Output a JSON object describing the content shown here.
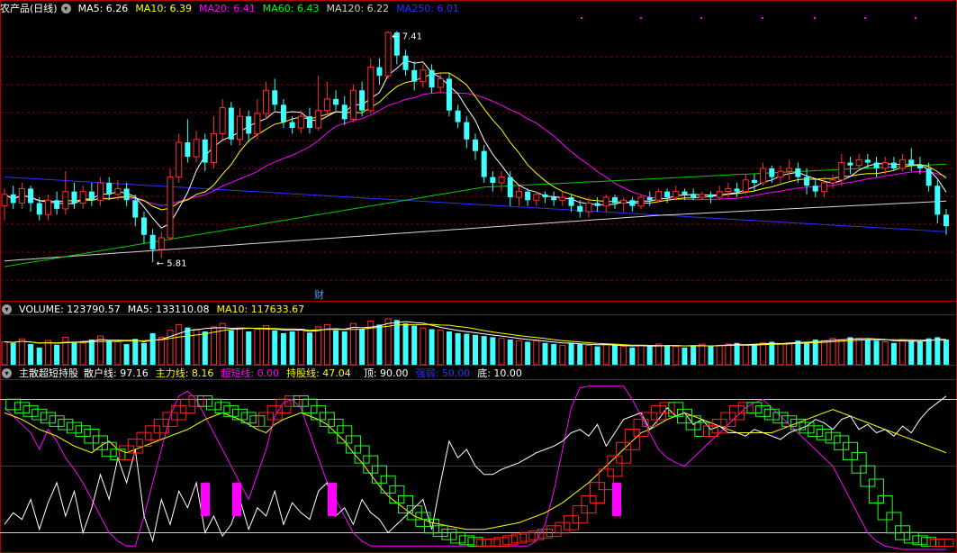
{
  "price": {
    "title": "农产品(日线)",
    "ma_labels": [
      {
        "text": "MA5: 6.26",
        "color": "#ffffff"
      },
      {
        "text": "MA10: 6.39",
        "color": "#ffff00"
      },
      {
        "text": "MA20: 6.41",
        "color": "#ff00ff"
      },
      {
        "text": "MA60: 6.43",
        "color": "#00ff00"
      },
      {
        "text": "MA120: 6.22",
        "color": "#d0d0d0"
      },
      {
        "text": "MA250: 6.01",
        "color": "#3030ff"
      }
    ],
    "high_label": "7.41",
    "low_label": "5.81",
    "fin_mark": "财"
  },
  "volume": {
    "labels": [
      {
        "text": "VOLUME: 123790.57",
        "color": "#ffffff"
      },
      {
        "text": "MA5: 133110.08",
        "color": "#ffffff"
      },
      {
        "text": "MA10: 117633.67",
        "color": "#ffff00"
      }
    ]
  },
  "indicator": {
    "labels": [
      {
        "text": "主散超短持股",
        "color": "#ffffff"
      },
      {
        "text": "散户线: 97.16",
        "color": "#ffffff"
      },
      {
        "text": "主力线: 8.16",
        "color": "#ffff00"
      },
      {
        "text": "超短线: 0.00",
        "color": "#ff00ff"
      },
      {
        "text": "持股线: 47.04",
        "color": "#ffff00"
      },
      {
        "text": "顶: 90.00",
        "color": "#ffffff"
      },
      {
        "text": "强弱: 50.00",
        "color": "#3030ff"
      },
      {
        "text": "底: 10.00",
        "color": "#ffffff"
      }
    ]
  },
  "chart_data": [
    {
      "type": "candlestick",
      "panel": "price",
      "ylim": [
        5.6,
        7.5
      ],
      "high": 7.41,
      "low": 5.81,
      "candles": [
        [
          6.2,
          6.28,
          6.1,
          6.32
        ],
        [
          6.28,
          6.22,
          6.18,
          6.34
        ],
        [
          6.22,
          6.32,
          6.18,
          6.36
        ],
        [
          6.32,
          6.22,
          6.16,
          6.34
        ],
        [
          6.22,
          6.14,
          6.1,
          6.26
        ],
        [
          6.14,
          6.24,
          6.1,
          6.28
        ],
        [
          6.24,
          6.18,
          6.14,
          6.3
        ],
        [
          6.18,
          6.3,
          6.14,
          6.44
        ],
        [
          6.3,
          6.22,
          6.18,
          6.36
        ],
        [
          6.22,
          6.3,
          6.18,
          6.34
        ],
        [
          6.3,
          6.24,
          6.2,
          6.36
        ],
        [
          6.24,
          6.36,
          6.2,
          6.4
        ],
        [
          6.36,
          6.28,
          6.24,
          6.4
        ],
        [
          6.28,
          6.32,
          6.24,
          6.38
        ],
        [
          6.32,
          6.24,
          6.2,
          6.36
        ],
        [
          6.24,
          6.12,
          6.06,
          6.28
        ],
        [
          6.12,
          6.0,
          5.94,
          6.16
        ],
        [
          6.0,
          5.9,
          5.81,
          6.04
        ],
        [
          5.9,
          5.98,
          5.84,
          6.02
        ],
        [
          5.98,
          6.4,
          5.96,
          6.46
        ],
        [
          6.4,
          6.64,
          6.36,
          6.7
        ],
        [
          6.64,
          6.54,
          6.5,
          6.8
        ],
        [
          6.54,
          6.66,
          6.5,
          6.72
        ],
        [
          6.66,
          6.5,
          6.44,
          6.7
        ],
        [
          6.5,
          6.7,
          6.46,
          6.82
        ],
        [
          6.7,
          6.88,
          6.66,
          6.94
        ],
        [
          6.88,
          6.66,
          6.62,
          6.92
        ],
        [
          6.66,
          6.82,
          6.62,
          6.88
        ],
        [
          6.82,
          6.7,
          6.64,
          6.86
        ],
        [
          6.7,
          6.84,
          6.66,
          6.94
        ],
        [
          6.84,
          7.0,
          6.8,
          7.06
        ],
        [
          7.0,
          6.9,
          6.86,
          7.08
        ],
        [
          6.9,
          6.78,
          6.74,
          6.94
        ],
        [
          6.78,
          6.74,
          6.7,
          6.82
        ],
        [
          6.74,
          6.82,
          6.7,
          6.86
        ],
        [
          6.82,
          6.74,
          6.7,
          6.88
        ],
        [
          6.74,
          6.86,
          6.72,
          7.1
        ],
        [
          6.86,
          6.94,
          6.82,
          7.06
        ],
        [
          6.94,
          6.9,
          6.86,
          7.0
        ],
        [
          6.9,
          6.8,
          6.76,
          6.96
        ],
        [
          6.8,
          7.0,
          6.78,
          7.04
        ],
        [
          7.0,
          6.86,
          6.82,
          7.06
        ],
        [
          6.86,
          7.16,
          6.84,
          7.22
        ],
        [
          7.16,
          7.1,
          7.04,
          7.22
        ],
        [
          7.1,
          7.4,
          7.08,
          7.41
        ],
        [
          7.4,
          7.24,
          7.18,
          7.41
        ],
        [
          7.24,
          7.14,
          7.1,
          7.28
        ],
        [
          7.14,
          7.06,
          7.0,
          7.2
        ],
        [
          7.06,
          7.14,
          7.02,
          7.18
        ],
        [
          7.14,
          7.02,
          6.98,
          7.18
        ],
        [
          7.02,
          7.08,
          6.98,
          7.12
        ],
        [
          7.08,
          6.86,
          6.82,
          7.12
        ],
        [
          6.86,
          6.78,
          6.74,
          6.9
        ],
        [
          6.78,
          6.66,
          6.6,
          6.82
        ],
        [
          6.66,
          6.58,
          6.52,
          6.7
        ],
        [
          6.58,
          6.4,
          6.36,
          6.62
        ],
        [
          6.4,
          6.36,
          6.3,
          6.44
        ],
        [
          6.36,
          6.4,
          6.3,
          6.44
        ],
        [
          6.4,
          6.26,
          6.2,
          6.44
        ],
        [
          6.26,
          6.3,
          6.2,
          6.34
        ],
        [
          6.3,
          6.24,
          6.2,
          6.32
        ],
        [
          6.24,
          6.28,
          6.2,
          6.3
        ],
        [
          6.28,
          6.26,
          6.22,
          6.3
        ],
        [
          6.26,
          6.24,
          6.2,
          6.3
        ],
        [
          6.24,
          6.26,
          6.2,
          6.3
        ],
        [
          6.26,
          6.2,
          6.16,
          6.28
        ],
        [
          6.2,
          6.16,
          6.12,
          6.24
        ],
        [
          6.16,
          6.22,
          6.12,
          6.26
        ],
        [
          6.22,
          6.2,
          6.16,
          6.26
        ],
        [
          6.2,
          6.26,
          6.16,
          6.28
        ],
        [
          6.26,
          6.22,
          6.18,
          6.28
        ],
        [
          6.22,
          6.24,
          6.16,
          6.26
        ],
        [
          6.24,
          6.2,
          6.16,
          6.26
        ],
        [
          6.2,
          6.26,
          6.18,
          6.28
        ],
        [
          6.26,
          6.24,
          6.2,
          6.3
        ],
        [
          6.24,
          6.3,
          6.22,
          6.32
        ],
        [
          6.3,
          6.26,
          6.22,
          6.32
        ],
        [
          6.26,
          6.3,
          6.24,
          6.34
        ],
        [
          6.3,
          6.28,
          6.24,
          6.32
        ],
        [
          6.28,
          6.26,
          6.24,
          6.32
        ],
        [
          6.26,
          6.28,
          6.24,
          6.3
        ],
        [
          6.28,
          6.26,
          6.22,
          6.3
        ],
        [
          6.26,
          6.3,
          6.24,
          6.34
        ],
        [
          6.3,
          6.32,
          6.26,
          6.36
        ],
        [
          6.32,
          6.3,
          6.26,
          6.36
        ],
        [
          6.3,
          6.38,
          6.28,
          6.42
        ],
        [
          6.38,
          6.36,
          6.3,
          6.42
        ],
        [
          6.36,
          6.46,
          6.34,
          6.5
        ],
        [
          6.46,
          6.4,
          6.36,
          6.48
        ],
        [
          6.4,
          6.44,
          6.36,
          6.48
        ],
        [
          6.44,
          6.46,
          6.38,
          6.52
        ],
        [
          6.46,
          6.4,
          6.36,
          6.5
        ],
        [
          6.4,
          6.34,
          6.28,
          6.46
        ],
        [
          6.34,
          6.3,
          6.26,
          6.38
        ],
        [
          6.3,
          6.36,
          6.26,
          6.4
        ],
        [
          6.36,
          6.38,
          6.32,
          6.42
        ],
        [
          6.38,
          6.5,
          6.34,
          6.56
        ],
        [
          6.5,
          6.48,
          6.42,
          6.54
        ],
        [
          6.48,
          6.52,
          6.46,
          6.56
        ],
        [
          6.52,
          6.5,
          6.46,
          6.56
        ],
        [
          6.5,
          6.46,
          6.4,
          6.54
        ],
        [
          6.46,
          6.5,
          6.42,
          6.54
        ],
        [
          6.5,
          6.46,
          6.44,
          6.54
        ],
        [
          6.46,
          6.52,
          6.44,
          6.56
        ],
        [
          6.52,
          6.48,
          6.44,
          6.6
        ],
        [
          6.48,
          6.46,
          6.42,
          6.54
        ],
        [
          6.46,
          6.34,
          6.3,
          6.5
        ],
        [
          6.34,
          6.14,
          6.08,
          6.38
        ],
        [
          6.14,
          6.06,
          6.0,
          6.18
        ]
      ]
    },
    {
      "type": "bar",
      "panel": "volume",
      "series_name": "VOLUME",
      "values": [
        40,
        38,
        45,
        36,
        30,
        42,
        35,
        48,
        40,
        38,
        44,
        50,
        42,
        40,
        36,
        45,
        38,
        55,
        48,
        60,
        70,
        65,
        62,
        58,
        66,
        72,
        60,
        64,
        58,
        62,
        68,
        60,
        55,
        58,
        62,
        56,
        66,
        70,
        60,
        58,
        72,
        62,
        76,
        70,
        80,
        78,
        72,
        68,
        64,
        62,
        60,
        58,
        55,
        54,
        52,
        50,
        48,
        46,
        44,
        42,
        40,
        42,
        38,
        36,
        34,
        38,
        36,
        34,
        32,
        36,
        34,
        32,
        30,
        34,
        32,
        36,
        34,
        32,
        30,
        34,
        36,
        32,
        34,
        36,
        38,
        34,
        36,
        38,
        40,
        36,
        38,
        42,
        40,
        44,
        42,
        46,
        44,
        48,
        46,
        44,
        42,
        40,
        38,
        44,
        42,
        40,
        46,
        48,
        44
      ]
    },
    {
      "type": "line",
      "panel": "indicator",
      "ylim": [
        0,
        100
      ],
      "reference_lines": {
        "顶": 90,
        "强弱": 50,
        "底": 10
      }
    }
  ]
}
